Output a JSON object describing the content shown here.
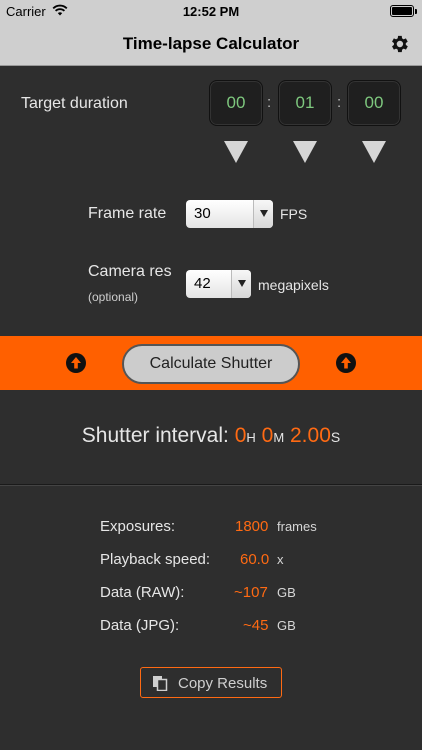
{
  "statusbar": {
    "carrier": "Carrier",
    "time": "12:52 PM"
  },
  "navbar": {
    "title": "Time-lapse Calculator",
    "settings_icon": "gear-icon"
  },
  "target": {
    "label": "Target duration",
    "hours": "00",
    "minutes": "01",
    "seconds": "00",
    "colon": ":"
  },
  "frame_rate": {
    "label": "Frame rate",
    "value": "30",
    "unit": "FPS"
  },
  "camera_res": {
    "label": "Camera res",
    "sublabel": "(optional)",
    "value": "42",
    "unit": "megapixels"
  },
  "calculate": {
    "label": "Calculate Shutter",
    "accent": "#ff6000"
  },
  "result": {
    "prefix": "Shutter interval:",
    "hours": "0",
    "hours_unit": "H",
    "minutes": "0",
    "minutes_unit": "M",
    "seconds": "2.00",
    "seconds_unit": "S"
  },
  "stats": {
    "exposures": {
      "label": "Exposures:",
      "value": "1800",
      "unit": "frames"
    },
    "playback": {
      "label": "Playback speed:",
      "value": "60.0",
      "unit": "x"
    },
    "raw": {
      "label": "Data (RAW):",
      "value": "~107",
      "unit": "GB"
    },
    "jpg": {
      "label": "Data (JPG):",
      "value": "~45",
      "unit": "GB"
    }
  },
  "copy": {
    "label": "Copy Results"
  }
}
